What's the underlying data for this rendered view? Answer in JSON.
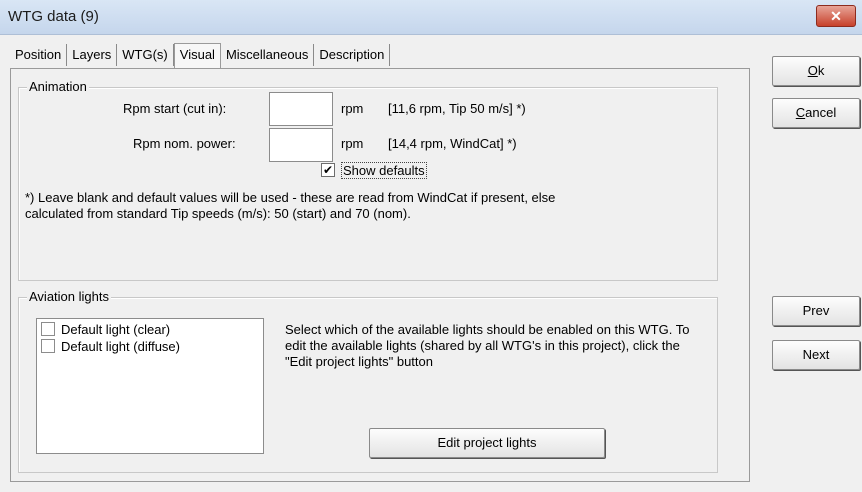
{
  "window": {
    "title": "WTG data  (9)",
    "close_glyph": "✕"
  },
  "tabs": [
    "Position",
    "Layers",
    "WTG(s)",
    "Visual",
    "Miscellaneous",
    "Description"
  ],
  "active_tab": "Visual",
  "animation": {
    "group_label": "Animation",
    "rpm_start_label": "Rpm start (cut in):",
    "rpm_start_value": "",
    "rpm_start_unit": "rpm",
    "rpm_start_default": "[11,6 rpm, Tip 50 m/s] *)",
    "rpm_nom_label": "Rpm nom. power:",
    "rpm_nom_value": "",
    "rpm_nom_unit": "rpm",
    "rpm_nom_default": "[14,4 rpm, WindCat] *)",
    "show_defaults_label": "Show defaults",
    "show_defaults_checked": true,
    "check_glyph": "✔",
    "note": "*) Leave blank and default values will be used - these are read from WindCat if present, else calculated from standard Tip speeds (m/s): 50 (start) and 70 (nom)."
  },
  "aviation": {
    "group_label": "Aviation lights",
    "lights": [
      {
        "label": "Default light (clear)",
        "checked": false
      },
      {
        "label": "Default light (diffuse)",
        "checked": false
      }
    ],
    "description": "Select which of the available lights should be enabled on this WTG. To edit the available lights (shared by all WTG's in this project), click the \"Edit project lights\" button",
    "edit_button": "Edit project lights"
  },
  "buttons": {
    "ok": "Ok",
    "cancel": "Cancel",
    "prev": "Prev",
    "next": "Next"
  }
}
